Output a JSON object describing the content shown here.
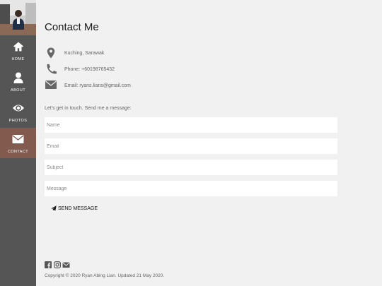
{
  "nav": [
    {
      "id": "home",
      "label": "HOME",
      "icon": "home-icon"
    },
    {
      "id": "about",
      "label": "ABOUT",
      "icon": "user-icon"
    },
    {
      "id": "photos",
      "label": "PHOTOS",
      "icon": "eye-icon"
    },
    {
      "id": "contact",
      "label": "CONTACT",
      "icon": "envelope-icon",
      "active": true
    }
  ],
  "contact": {
    "title": "Contact Me",
    "location": "Kuching, Sarawak",
    "phone": "Phone: +60198765432",
    "email": "Email: ryans.lians@gmail.com",
    "intro": "Let's get in touch. Send me a message:"
  },
  "form": {
    "name_placeholder": "Name",
    "email_placeholder": "Email",
    "subject_placeholder": "Subject",
    "message_placeholder": "Message",
    "send_label": "SEND MESSAGE"
  },
  "footer": {
    "social_icons": [
      "facebook-icon",
      "instagram-icon",
      "envelope-icon"
    ],
    "copyright": "Copyright © 2020 Ryan Abing Lian. Updated 21 May 2020."
  },
  "colors": {
    "sidebar": "#555555",
    "active_nav": "#825a4e",
    "background": "#f1f1f1"
  }
}
